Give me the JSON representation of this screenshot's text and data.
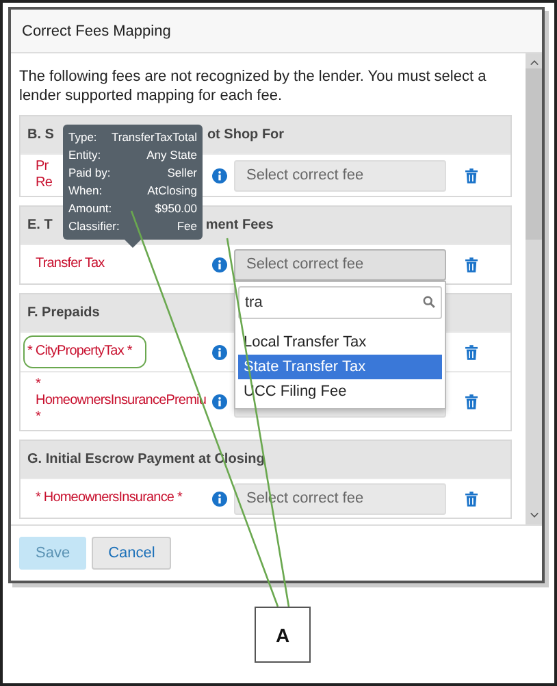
{
  "dialog": {
    "title": "Correct Fees Mapping",
    "message": "The following fees are not recognized by the lender. You must select a lender supported mapping for each fee.",
    "sections": [
      {
        "heading_parts": [
          "B. S",
          "ot Shop For"
        ],
        "fees": [
          {
            "name_lines": [
              "Pr",
              "Re"
            ],
            "highlighted": false,
            "dropdown_open": false,
            "placeholder": "Select correct fee"
          }
        ]
      },
      {
        "heading_parts": [
          "E. T",
          "ment Fees"
        ],
        "fees": [
          {
            "name_lines": [
              "Transfer Tax"
            ],
            "highlighted": false,
            "dropdown_open": true,
            "placeholder": "Select correct fee"
          }
        ]
      },
      {
        "heading_parts": [
          "F. Prepaids"
        ],
        "fees": [
          {
            "name_lines": [
              "* CityPropertyTax *"
            ],
            "highlighted": true,
            "dropdown_open": false
          },
          {
            "name_lines": [
              "*",
              "HomeownersInsurancePremiu",
              "*"
            ],
            "highlighted": false,
            "dropdown_open": false
          }
        ]
      },
      {
        "heading_parts": [
          "G. Initial Escrow Payment at Closing"
        ],
        "fees": [
          {
            "name_lines": [
              "* HomeownersInsurance *"
            ],
            "highlighted": false,
            "dropdown_open": false,
            "placeholder": "Select correct fee"
          }
        ]
      }
    ]
  },
  "tooltip": {
    "rows": [
      {
        "label": "Type:",
        "value": "TransferTaxTotal"
      },
      {
        "label": "Entity:",
        "value": "Any State"
      },
      {
        "label": "Paid by:",
        "value": "Seller"
      },
      {
        "label": "When:",
        "value": "AtClosing"
      },
      {
        "label": "Amount:",
        "value": "$950.00"
      },
      {
        "label": "Classifier:",
        "value": "Fee"
      }
    ]
  },
  "dropdown": {
    "search_value": "tra",
    "options": [
      {
        "label": "Local Transfer Tax",
        "selected": false
      },
      {
        "label": "State Transfer Tax",
        "selected": true
      },
      {
        "label": "UCC Filing Fee",
        "selected": false
      }
    ]
  },
  "buttons": [
    {
      "label": "Save",
      "disabled": true
    },
    {
      "label": "Cancel",
      "disabled": false
    }
  ],
  "callout": {
    "label": "A"
  }
}
